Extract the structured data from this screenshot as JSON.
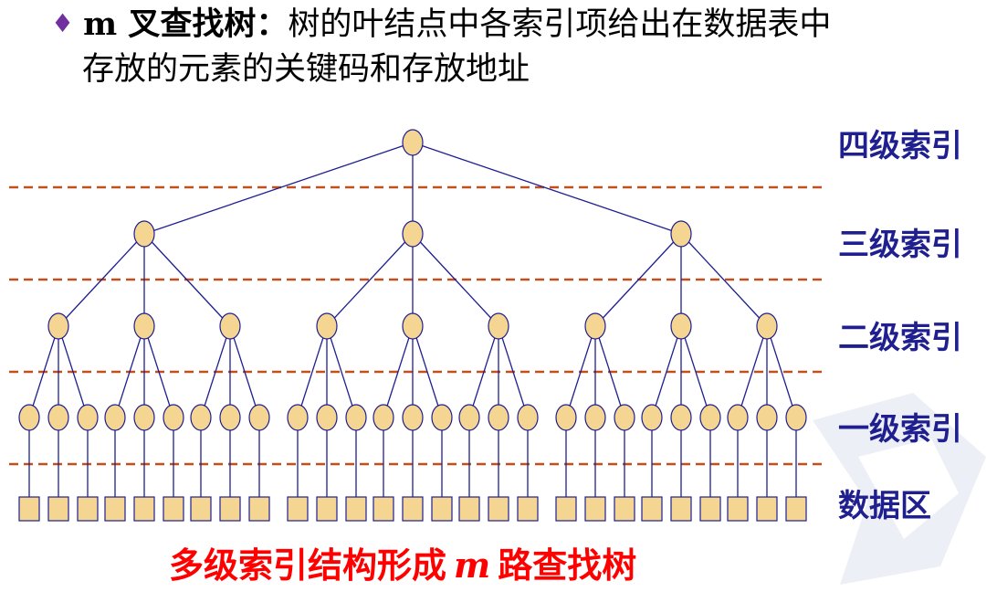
{
  "header": {
    "bullet": "♦",
    "term_letter": "m",
    "term_rest": " 叉查找树：",
    "line1_text": "树的叶结点中各索引项给出在数据表中",
    "line2_text": "存放的元素的关键码和存放地址"
  },
  "levels": [
    "四级索引",
    "三级索引",
    "二级索引",
    "一级索引",
    "数据区"
  ],
  "caption": {
    "before": "多级索引结构形成",
    "letter": "m",
    "after": "路查找树"
  },
  "colors": {
    "node_fill": "#f5d592",
    "node_stroke": "#1f1f8f",
    "edge": "#1f1f8f",
    "dashed_line": "#c0501f",
    "label": "#1f1f8f",
    "caption": "#ff0000"
  }
}
